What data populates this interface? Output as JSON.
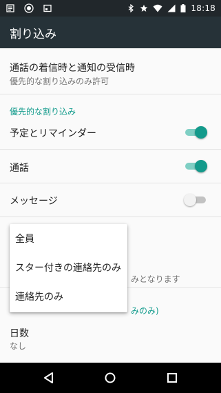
{
  "status_bar": {
    "time": "18:18",
    "left_icons": [
      "notification-icon",
      "debug-icon",
      "cast-icon"
    ],
    "right_icons": [
      "bluetooth-icon",
      "star-icon",
      "wifi-icon",
      "signal-icon",
      "battery-icon"
    ]
  },
  "app_bar": {
    "title": "割り込み"
  },
  "settings": {
    "calls_notifications": {
      "title": "通話の着信時と通知の受信時",
      "summary": "優先的な割り込みのみ許可"
    },
    "priority_section_header": "優先的な割り込み",
    "reminders": {
      "title": "予定とリマインダー",
      "on": true
    },
    "calls": {
      "title": "通話",
      "on": true
    },
    "messages": {
      "title": "メッセージ",
      "on": false
    },
    "hidden_summary_fragment": "みとなります",
    "hidden_header_fragment": "みのみ)",
    "days": {
      "title": "日数",
      "summary": "なし"
    }
  },
  "messages_from_menu": {
    "options": [
      "全員",
      "スター付きの連絡先のみ",
      "連絡先のみ"
    ]
  },
  "navigation": {
    "buttons": [
      "back-icon",
      "home-icon",
      "recents-icon"
    ]
  },
  "colors": {
    "accent": "#129b8c",
    "app_bar": "#263238",
    "status_bar": "#21272b"
  }
}
